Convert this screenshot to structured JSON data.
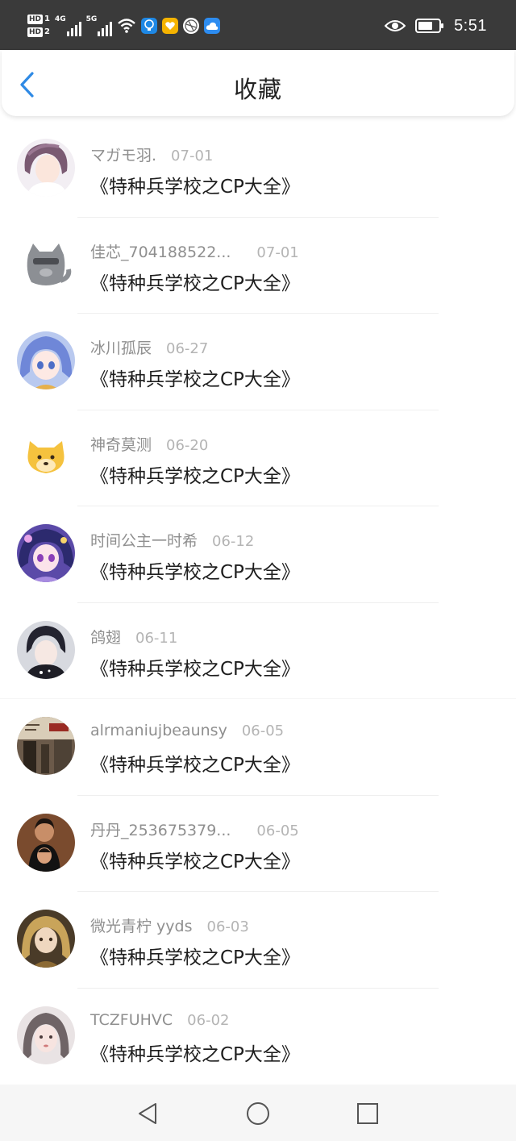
{
  "status_bar": {
    "sim1": "HD 1",
    "sim2": "HD 2",
    "net1": "4G",
    "net2": "5G",
    "time": "5:51"
  },
  "header": {
    "title": "收藏"
  },
  "favorites": [
    {
      "user": "マガモ羽.",
      "date": "07-01",
      "title": "《特种兵学校之CP大全》"
    },
    {
      "user": "佳芯_704188522...",
      "date": "07-01",
      "title": "《特种兵学校之CP大全》"
    },
    {
      "user": "冰川孤辰",
      "date": "06-27",
      "title": "《特种兵学校之CP大全》"
    },
    {
      "user": "神奇莫测",
      "date": "06-20",
      "title": "《特种兵学校之CP大全》"
    },
    {
      "user": "时间公主一时希",
      "date": "06-12",
      "title": "《特种兵学校之CP大全》"
    },
    {
      "user": "鸽翅",
      "date": "06-11",
      "title": "《特种兵学校之CP大全》"
    },
    {
      "user": "alrmaniujbeaunsy",
      "date": "06-05",
      "title": "《特种兵学校之CP大全》"
    },
    {
      "user": "丹丹_253675379...",
      "date": "06-05",
      "title": "《特种兵学校之CP大全》"
    },
    {
      "user": "微光青柠 yyds",
      "date": "06-03",
      "title": "《特种兵学校之CP大全》"
    },
    {
      "user": "TCZFUHVC",
      "date": "06-02",
      "title": "《特种兵学校之CP大全》"
    }
  ],
  "colors": {
    "status_bar_bg": "#3a3a3a",
    "accent_back": "#2f8ae5",
    "username": "#8f8f8f",
    "date": "#b4b4b4",
    "nav_bg": "#f6f6f6"
  }
}
